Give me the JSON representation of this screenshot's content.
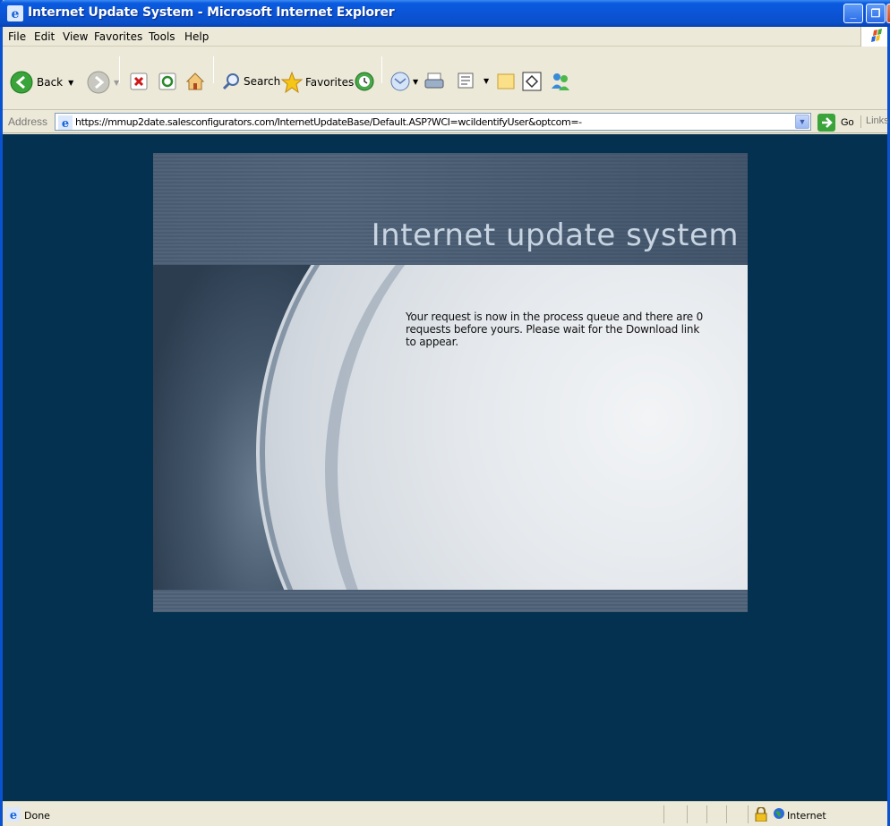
{
  "window": {
    "title": "Internet Update System - Microsoft Internet Explorer",
    "min_glyph": "_",
    "max_glyph": "❐",
    "close_glyph": "✕"
  },
  "menu": {
    "items": [
      "File",
      "Edit",
      "View",
      "Favorites",
      "Tools",
      "Help"
    ]
  },
  "toolbar": {
    "back_label": "Back",
    "search_label": "Search",
    "favorites_label": "Favorites",
    "icons": [
      "back-icon",
      "forward-icon",
      "stop-icon",
      "refresh-icon",
      "home-icon",
      "search-icon",
      "favorites-star-icon",
      "history-icon",
      "mail-icon",
      "print-icon",
      "edit-icon",
      "folder-icon",
      "messenger-icon",
      "discuss-icon"
    ]
  },
  "address": {
    "label": "Address",
    "url": "https://mmup2date.salesconfigurators.com/InternetUpdateBase/Default.ASP?WCI=wciIdentifyUser&optcom=-",
    "go_label": "Go",
    "links_label": "Links"
  },
  "page": {
    "banner_title": "Internet update system",
    "message": "Your request is now in the process queue and there are 0 requests before yours. Please wait for the Download link to appear."
  },
  "status": {
    "text": "Done",
    "zone": "Internet"
  },
  "colors": {
    "title_bar": "#0a54d6",
    "page_background": "#04314f",
    "chrome": "#ece9d8"
  }
}
